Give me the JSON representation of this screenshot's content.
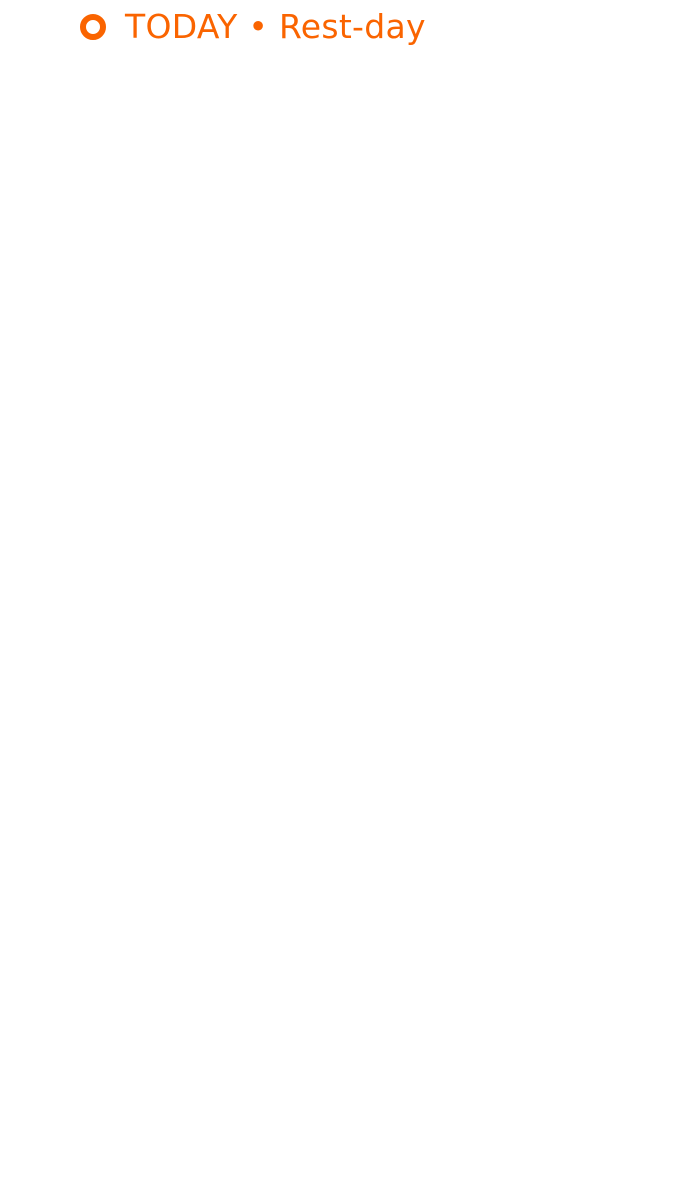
{
  "today": {
    "label": "TODAY • Rest-day",
    "icon": "target-ring-icon"
  },
  "colors": {
    "accent": "#fa6400",
    "background": "#ffffff"
  }
}
